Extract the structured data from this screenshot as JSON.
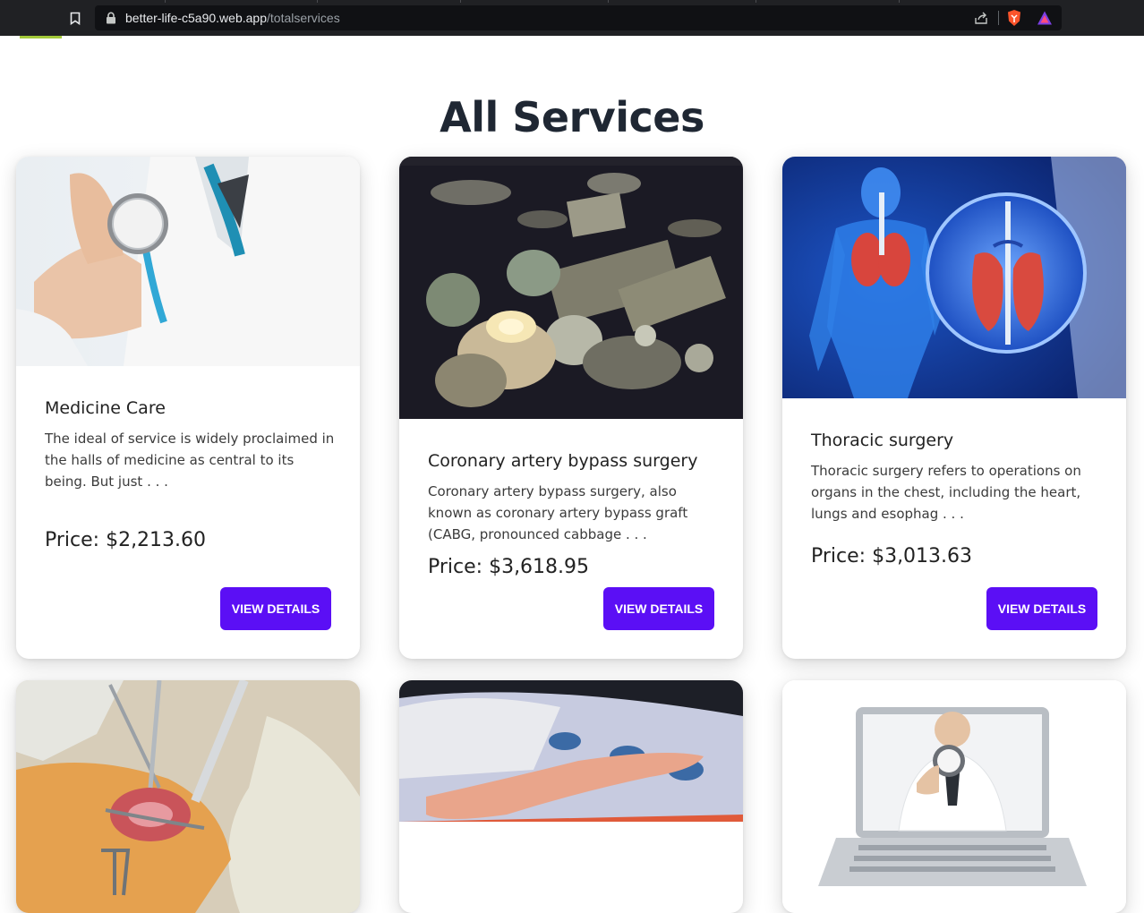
{
  "browser": {
    "url_host": "better-life-c5a90.web.app",
    "url_path": "/totalservices"
  },
  "page": {
    "title": "All Services"
  },
  "services": [
    {
      "title": "Medicine Care",
      "description": "The ideal of service is widely proclaimed in the halls of medicine as central to its being. But just . . .",
      "price": "Price: $2,213.60",
      "button": "VIEW DETAILS"
    },
    {
      "title": "Coronary artery bypass surgery",
      "description": "Coronary artery bypass surgery, also known as coronary artery bypass graft (CABG, pronounced cabbage . . .",
      "price": "Price: $3,618.95",
      "button": "VIEW DETAILS"
    },
    {
      "title": "Thoracic surgery",
      "description": "Thoracic surgery refers to operations on organs in the chest, including the heart, lungs and esophag . . .",
      "price": "Price: $3,013.63",
      "button": "VIEW DETAILS"
    },
    {
      "title": "",
      "description": "",
      "price": "",
      "button": ""
    },
    {
      "title": "",
      "description": "",
      "price": "",
      "button": ""
    },
    {
      "title": "",
      "description": "",
      "price": "",
      "button": ""
    }
  ],
  "colors": {
    "accent": "#5b0ff5",
    "heading": "#1f2733",
    "browser_bg": "#202124"
  },
  "icons": [
    "bookmark-icon",
    "lock-icon",
    "share-icon",
    "brave-shield-icon",
    "brave-rewards-icon"
  ]
}
